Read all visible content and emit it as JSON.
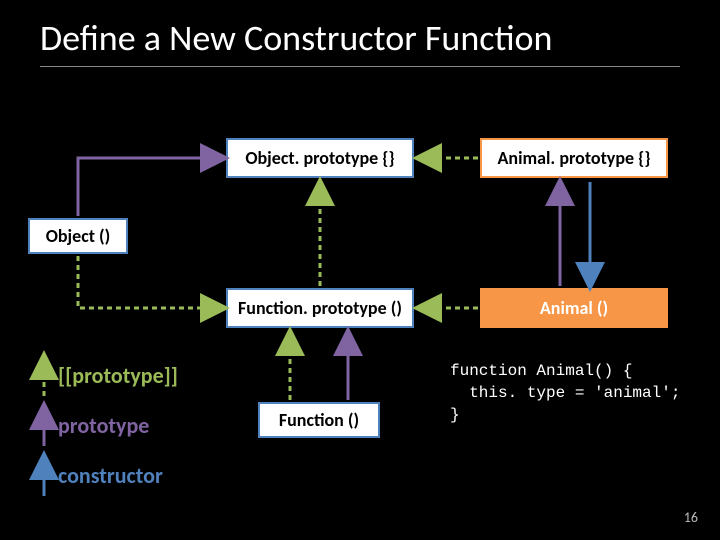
{
  "title": "Define a New Constructor Function",
  "boxes": {
    "object_prototype": "Object. prototype {}",
    "animal_prototype": "Animal. prototype {}",
    "object_fn": "Object ()",
    "function_prototype": "Function. prototype ()",
    "animal_fn": "Animal ()",
    "function_fn": "Function ()"
  },
  "legend": {
    "proto_chain": "[[prototype]]",
    "prototype_prop": "prototype",
    "constructor_prop": "constructor"
  },
  "code": {
    "line1": "function Animal() {",
    "line2": "  this. type = 'animal';",
    "line3": "}"
  },
  "page_number": "16",
  "colors": {
    "blue": "#4f81bd",
    "orange": "#f79646",
    "green": "#9bbb59",
    "purple": "#8064a2"
  }
}
